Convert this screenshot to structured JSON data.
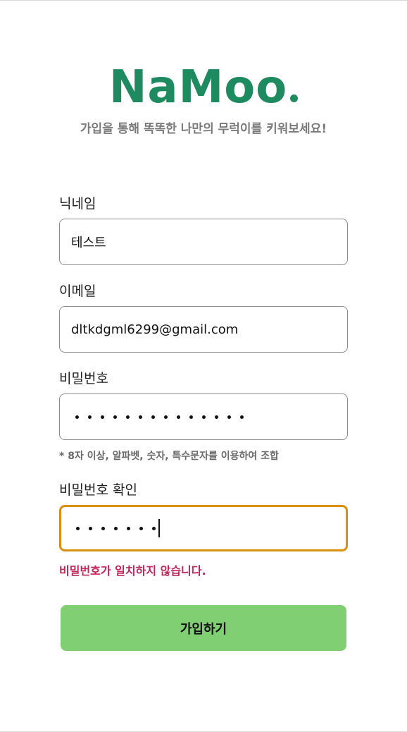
{
  "app": {
    "logo_text": "NaMoo",
    "logo_dot_color": "#1e8a5f",
    "subtitle": "가입을 통해 똑똑한 나만의 무럭이를 키워보세요!"
  },
  "form": {
    "nickname": {
      "label": "닉네임",
      "value": "테스트"
    },
    "email": {
      "label": "이메일",
      "value": "dltkdgml6299@gmail.com"
    },
    "password": {
      "label": "비밀번호",
      "masked_length": 14,
      "hint": "* 8자 이상, 알파벳, 숫자, 특수문자를 이용하여 조합"
    },
    "password_confirm": {
      "label": "비밀번호 확인",
      "masked_length": 7,
      "focused": true,
      "error": "비밀번호가 일치하지 않습니다."
    },
    "submit_label": "가입하기"
  },
  "colors": {
    "brand": "#1e8a5f",
    "focus_border": "#d98f0f",
    "error": "#c2245a",
    "submit_bg": "#80cf72"
  }
}
